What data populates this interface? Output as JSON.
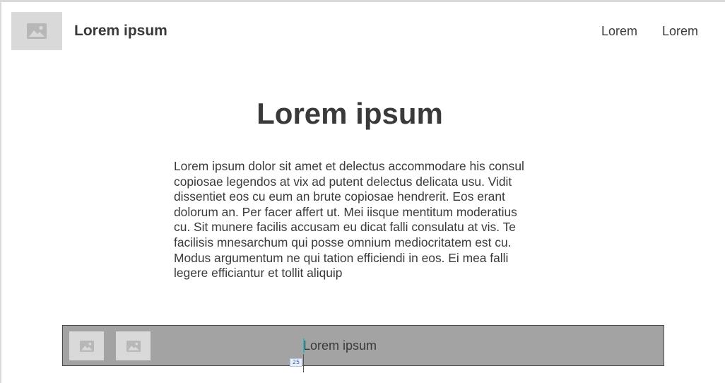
{
  "header": {
    "brand": "Lorem ipsum",
    "logo_icon": "image-placeholder-icon",
    "nav": [
      {
        "label": "Lorem"
      },
      {
        "label": "Lorem"
      }
    ]
  },
  "hero": {
    "title": "Lorem ipsum",
    "paragraph": "Lorem ipsum dolor sit amet et delectus accommodare his consul copiosae legendos at vix ad putent delectus delicata usu. Vidit dissentiet eos cu eum an brute copiosae hendrerit. Eos erant dolorum an. Per facer affert ut. Mei iisque mentitum moderatius cu. Sit munere facilis accusam eu dicat falli consulatu at vis. Te facilisis mnesarchum qui posse omnium mediocritatem est cu. Modus argumentum ne qui tation efficiendi in eos. Ei mea falli legere efficiantur et tollit aliquip"
  },
  "footer": {
    "images": [
      {
        "icon": "image-placeholder-icon"
      },
      {
        "icon": "image-placeholder-icon"
      }
    ],
    "text": "Lorem ipsum"
  },
  "editor_overlay": {
    "badge": "25"
  },
  "colors": {
    "placeholder": "#d9d9d9",
    "footer_bg": "#a3a3a3",
    "text": "#3a3a3a",
    "caret": "#2bb7c8"
  }
}
